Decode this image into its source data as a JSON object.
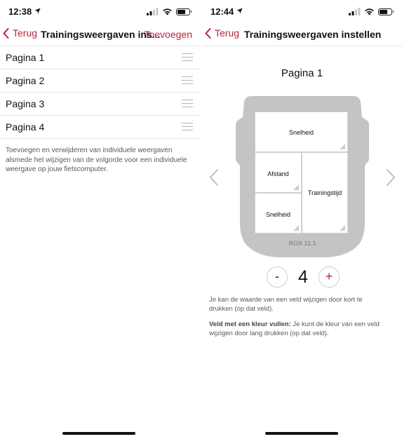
{
  "left": {
    "status_time": "12:38",
    "back_label": "Terug",
    "nav_title": "Trainingsweergaven ins...",
    "action_label": "Toevoegen",
    "pages": [
      {
        "label": "Pagina 1"
      },
      {
        "label": "Pagina 2"
      },
      {
        "label": "Pagina 3"
      },
      {
        "label": "Pagina 4"
      }
    ],
    "help_text": "Toevoegen en verwijderen van individuele weergaven alsmede het wijzigen van de volgorde voor een individuele weergave op jouw fietscomputer."
  },
  "right": {
    "status_time": "12:44",
    "back_label": "Terug",
    "nav_title": "Trainingsweergaven instellen",
    "page_title": "Pagina 1",
    "fields": {
      "top": "Snelheid",
      "middle_left": "Afstand",
      "right": "Trainingstijd",
      "bottom_left": "Snelheid"
    },
    "device_name": "ROX 11.1",
    "stepper": {
      "minus": "-",
      "value": "4",
      "plus": "+"
    },
    "info_1": "Je kan de waarde van een veld wijzigen door kort te drukken (op dat veld).",
    "info_2_bold": "Veld met een kleur vullen:",
    "info_2_rest": " Je kunt de kleur van een veld wijzigen door lang drukken (op dat veld)."
  },
  "colors": {
    "accent": "#b32640",
    "device_body": "#c4c4c4",
    "divider": "#e4e4e4"
  },
  "icons": [
    "location-arrow-icon",
    "signal-bars-icon",
    "wifi-icon",
    "battery-icon",
    "chevron-left-icon",
    "drag-handle-icon",
    "chevron-right-icon"
  ]
}
